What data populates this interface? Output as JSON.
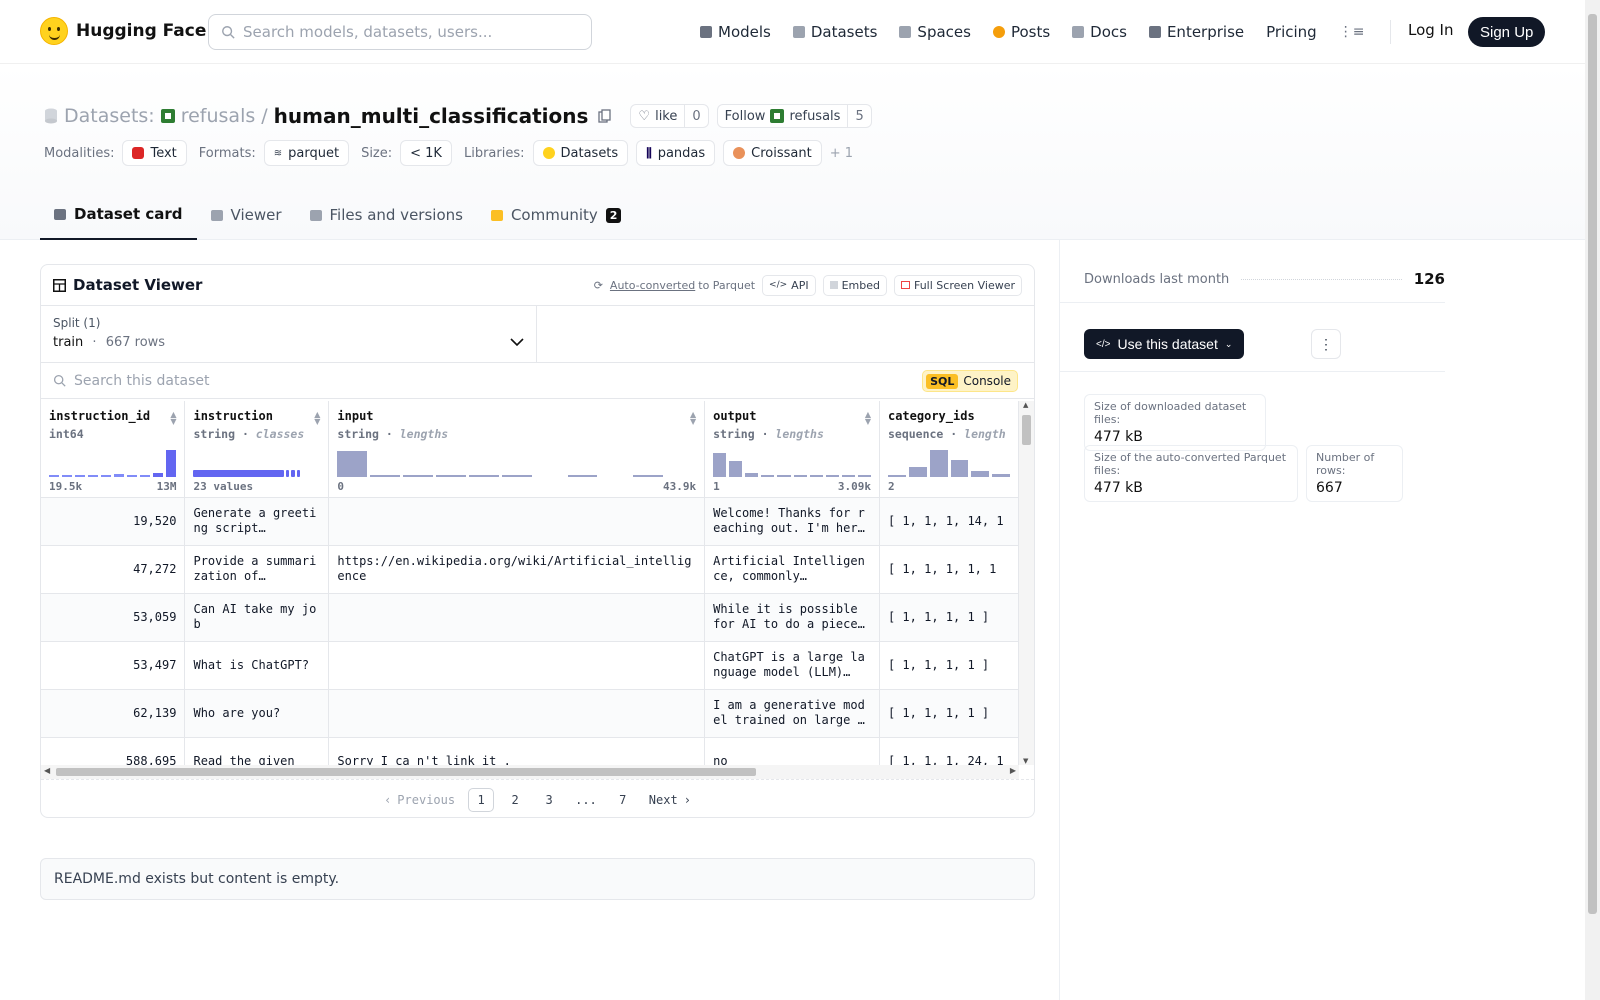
{
  "header": {
    "logo_text": "Hugging Face",
    "search_placeholder": "Search models, datasets, users...",
    "nav": [
      {
        "label": "Models",
        "icon": "cube-icon",
        "color": "#6b7280"
      },
      {
        "label": "Datasets",
        "icon": "database-icon",
        "color": "#9ca3af"
      },
      {
        "label": "Spaces",
        "icon": "grid-icon",
        "color": "#9ca3af"
      },
      {
        "label": "Posts",
        "icon": "post-icon",
        "color": "#f59e0b"
      },
      {
        "label": "Docs",
        "icon": "docs-icon",
        "color": "#9ca3af"
      },
      {
        "label": "Enterprise",
        "icon": "enterprise-icon",
        "color": "#6b7280"
      },
      {
        "label": "Pricing",
        "icon": "",
        "color": ""
      }
    ],
    "login": "Log In",
    "signup": "Sign Up"
  },
  "repo": {
    "type_label": "Datasets:",
    "org": "refusals",
    "slash": "/",
    "name": "human_multi_classifications",
    "like_label": "like",
    "like_count": "0",
    "follow_label": "Follow",
    "follow_org": "refusals",
    "follow_count": "5",
    "modalities_label": "Modalities:",
    "modality": "Text",
    "formats_label": "Formats:",
    "format": "parquet",
    "size_label": "Size:",
    "size": "< 1K",
    "libraries_label": "Libraries:",
    "libraries": [
      "Datasets",
      "pandas",
      "Croissant"
    ],
    "libraries_more": "+ 1"
  },
  "tabs": [
    {
      "label": "Dataset card",
      "icon": "card-icon"
    },
    {
      "label": "Viewer",
      "icon": "table-icon"
    },
    {
      "label": "Files and versions",
      "icon": "files-icon"
    },
    {
      "label": "Community",
      "icon": "community-icon",
      "badge": "2"
    }
  ],
  "viewer": {
    "title": "Dataset Viewer",
    "auto_converted": "Auto-converted",
    "to_parquet": "to Parquet",
    "api": "API",
    "embed": "Embed",
    "full_screen": "Full Screen Viewer",
    "split_label": "Split (1)",
    "split_name": "train",
    "split_sep": "·",
    "split_rows": "667 rows",
    "search_placeholder": "Search this dataset",
    "sql_badge": "SQL",
    "sql_label": "Console",
    "columns": [
      {
        "name": "instruction_id",
        "type": "int64",
        "sub": "",
        "min": "19.5k",
        "max": "13M",
        "hist": [
          0.05,
          0.05,
          0.05,
          0.05,
          0.05,
          0.08,
          0.05,
          0.05,
          0.12,
          0.95
        ],
        "hist_style": "blue"
      },
      {
        "name": "instruction",
        "type": "string",
        "sub": "classes",
        "min": "23 values",
        "max": "",
        "hist": [],
        "hist_style": "classes"
      },
      {
        "name": "input",
        "type": "string",
        "sub": "lengths",
        "min": "0",
        "max": "43.9k",
        "hist": [
          0.9,
          0.05,
          0.05,
          0.05,
          0.05,
          0.05,
          0,
          0.05,
          0,
          0.05,
          0
        ],
        "hist_style": "gray"
      },
      {
        "name": "output",
        "type": "string",
        "sub": "lengths",
        "min": "1",
        "max": "3.09k",
        "hist": [
          0.85,
          0.55,
          0.12,
          0.06,
          0.05,
          0.05,
          0.05,
          0.05,
          0.05,
          0.05
        ],
        "hist_style": "gray"
      },
      {
        "name": "category_ids",
        "type": "sequence",
        "sub": "length",
        "min": "2",
        "max": "",
        "hist": [
          0.05,
          0.35,
          0.95,
          0.6,
          0.2,
          0.08
        ],
        "hist_style": "gray"
      }
    ],
    "rows": [
      [
        "19,520",
        "Generate a greeting script…",
        "",
        "Welcome! Thanks for reaching out. I'm here…",
        "[ 1, 1, 1, 14, 1"
      ],
      [
        "47,272",
        "Provide a summarization of…",
        "https://en.wikipedia.org/wiki/Artificial_intelligence",
        "Artificial Intelligence, commonly…",
        "[ 1, 1, 1, 1, 1"
      ],
      [
        "53,059",
        "Can AI take my job",
        "",
        "While it is possible for AI to do a piece o…",
        "[ 1, 1, 1, 1 ]"
      ],
      [
        "53,497",
        "What is ChatGPT?",
        "",
        "ChatGPT is a large language model (LLM)…",
        "[ 1, 1, 1, 1 ]"
      ],
      [
        "62,139",
        "Who are you?",
        "",
        "I am a generative model trained on large corpu…",
        "[ 1, 1, 1, 1 ]"
      ],
      [
        "588,695",
        "Read the given",
        "Sorry I ca n't link it .",
        "no",
        "[ 1, 1, 1, 24, 1"
      ]
    ],
    "pager": {
      "prev": "Previous",
      "pages": [
        "1",
        "2",
        "3",
        "...",
        "7"
      ],
      "next": "Next"
    }
  },
  "readme": "README.md exists but content is empty.",
  "sidebar": {
    "downloads_label": "Downloads last month",
    "downloads_count": "126",
    "use_dataset": "Use this dataset",
    "more": "⋮",
    "stats": [
      {
        "label": "Size of downloaded dataset files:",
        "value": "477 kB"
      },
      {
        "label": "Size of the auto-converted Parquet files:",
        "value": "477 kB"
      },
      {
        "label": "Number of rows:",
        "value": "667"
      }
    ]
  }
}
